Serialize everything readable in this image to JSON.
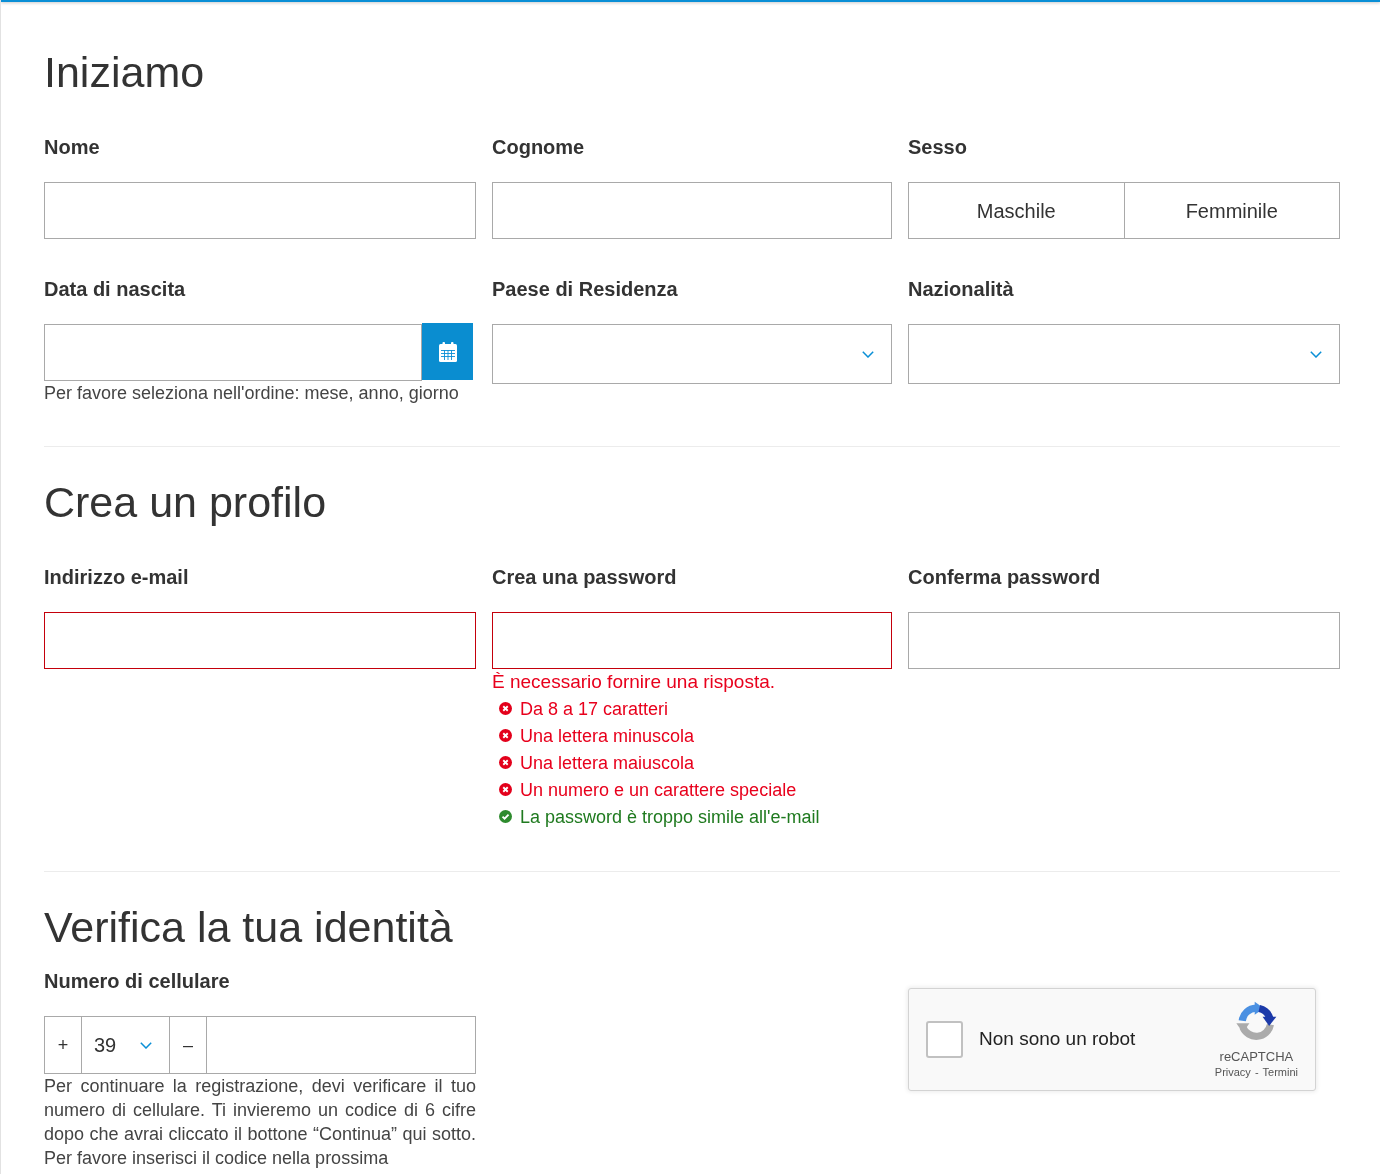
{
  "sections": [
    {
      "title": "Iniziamo",
      "fields": [
        {
          "kind": "text",
          "label": "Nome",
          "invalid": false
        },
        {
          "kind": "text",
          "label": "Cognome",
          "invalid": false
        },
        {
          "kind": "toggle",
          "label": "Sesso",
          "options": [
            {
              "label": "Maschile",
              "selected": false
            },
            {
              "label": "Femminile",
              "selected": false
            }
          ]
        },
        {
          "kind": "date",
          "label": "Data di nascita",
          "hint": "Per favore seleziona nell'ordine: mese, anno, giorno"
        },
        {
          "kind": "select",
          "label": "Paese di Residenza"
        },
        {
          "kind": "select",
          "label": "Nazionalità"
        }
      ]
    },
    {
      "title": "Crea un profilo",
      "fields": [
        {
          "kind": "text",
          "label": "Indirizzo e-mail",
          "invalid": true
        },
        {
          "kind": "text",
          "label": "Crea una password",
          "invalid": true,
          "error": "È necessario fornire una risposta.",
          "rules": [
            {
              "text": "Da 8 a 17 caratteri",
              "met": false
            },
            {
              "text": "Una lettera minuscola",
              "met": false
            },
            {
              "text": "Una lettera maiuscola",
              "met": false
            },
            {
              "text": "Un numero e un carattere speciale",
              "met": false
            },
            {
              "text": "La password è troppo simile all'e-mail",
              "met": true
            }
          ]
        },
        {
          "kind": "text",
          "label": "Conferma password",
          "invalid": false
        }
      ]
    },
    {
      "title": "Verifica la tua identità",
      "fields": [
        {
          "kind": "phone",
          "label": "Numero di cellulare",
          "prefix": "+",
          "country_code": "39",
          "separator": "–",
          "note": "Per continuare la registrazione, devi verificare il tuo numero di cellulare. Ti invieremo un codice di 6 cifre dopo che avrai cliccato il bottone “Continua” qui sotto. Per favore inserisci il codice nella prossima"
        },
        {
          "kind": "captcha",
          "label": "Non sono un robot",
          "checked": false,
          "brand": "reCAPTCHA",
          "links": [
            {
              "label": "Privacy"
            },
            {
              "label": "Termini"
            }
          ],
          "link_separator": "-"
        }
      ]
    }
  ]
}
